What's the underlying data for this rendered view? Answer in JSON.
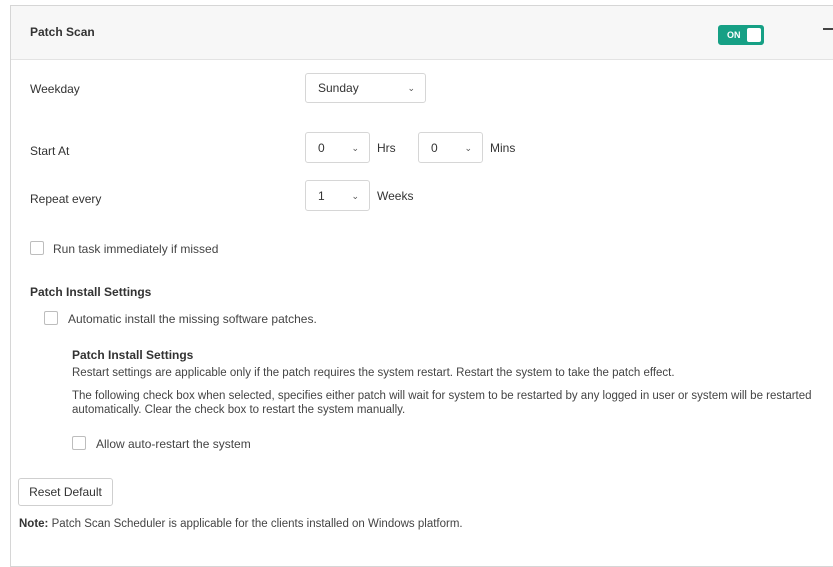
{
  "panel": {
    "title": "Patch Scan",
    "toggle_label": "ON"
  },
  "schedule": {
    "weekday_label": "Weekday",
    "weekday_value": "Sunday",
    "start_label": "Start At",
    "hours_value": "0",
    "hours_unit": "Hrs",
    "mins_value": "0",
    "mins_unit": "Mins",
    "repeat_label": "Repeat every",
    "repeat_value": "1",
    "repeat_unit": "Weeks",
    "run_missed_label": "Run task immediately if missed"
  },
  "install": {
    "section_title": "Patch Install Settings",
    "auto_install_label": "Automatic install the missing software patches.",
    "sub_title": "Patch Install Settings",
    "para1": "Restart settings are applicable only if the patch requires the system restart. Restart the system to take the patch effect.",
    "para2": "The following check box when selected, specifies either patch will wait for system to be restarted by any logged in user or system will be restarted automatically. Clear the check box to restart the system manually.",
    "auto_restart_label": "Allow auto-restart the system"
  },
  "actions": {
    "reset_label": "Reset Default"
  },
  "note": {
    "prefix": "Note:",
    "text": " Patch Scan Scheduler is applicable for the clients installed on Windows platform."
  },
  "icons": {
    "chevron": "chevron-down-icon",
    "collapse": "minus-icon"
  },
  "colors": {
    "toggle_on": "#16a085",
    "header_bg": "#f7f7f7"
  }
}
